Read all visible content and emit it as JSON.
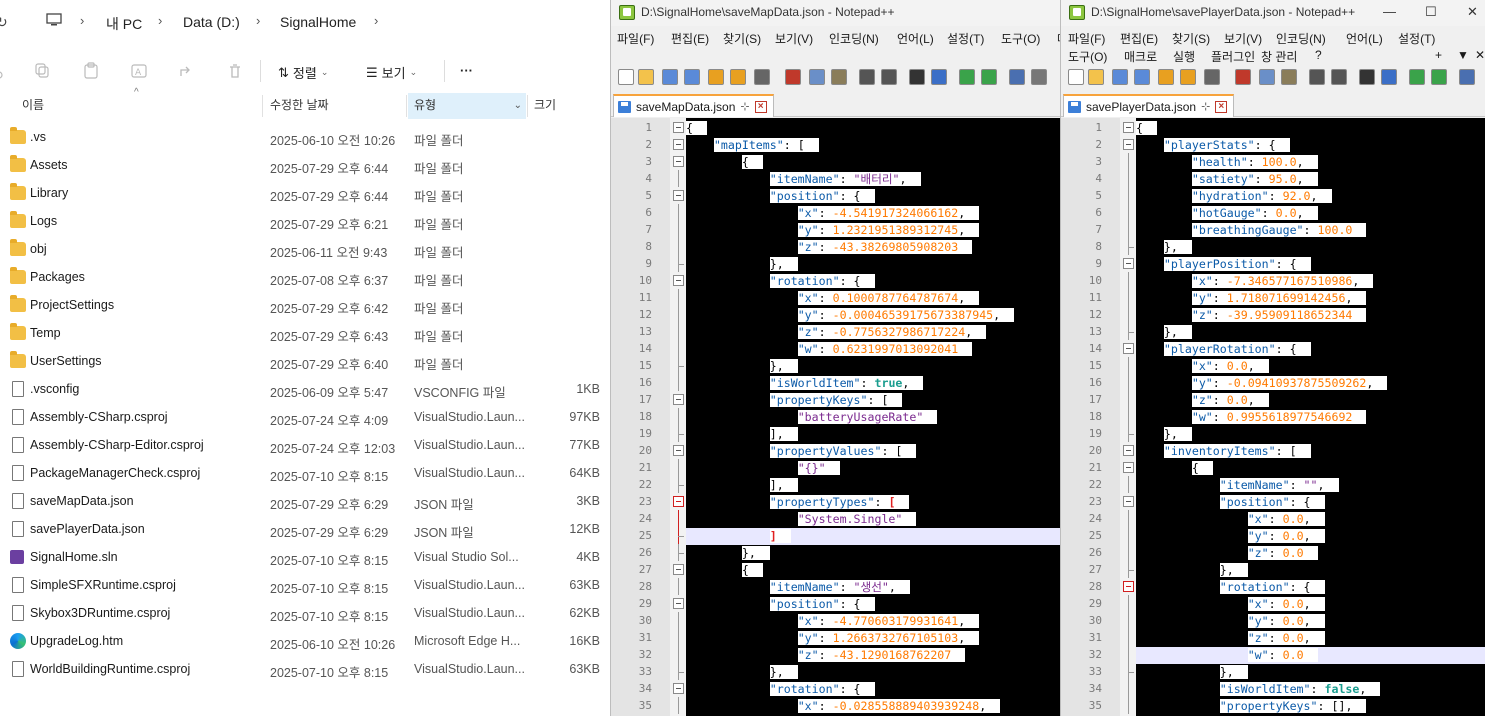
{
  "explorer": {
    "breadcrumb": [
      "내 PC",
      "Data (D:)",
      "SignalHome"
    ],
    "toolbar": {
      "sort_label": "정렬",
      "view_label": "보기",
      "more_label": "···"
    },
    "columns": {
      "name": "이름",
      "modified": "수정한 날짜",
      "type": "유형",
      "size": "크기"
    },
    "files": [
      {
        "icon": "folder-icon",
        "name": ".vs",
        "date": "2025-06-10 오전 10:26",
        "type": "파일 폴더",
        "size": ""
      },
      {
        "icon": "folder-icon",
        "name": "Assets",
        "date": "2025-07-29 오후 6:44",
        "type": "파일 폴더",
        "size": ""
      },
      {
        "icon": "folder-icon",
        "name": "Library",
        "date": "2025-07-29 오후 6:44",
        "type": "파일 폴더",
        "size": ""
      },
      {
        "icon": "folder-icon",
        "name": "Logs",
        "date": "2025-07-29 오후 6:21",
        "type": "파일 폴더",
        "size": ""
      },
      {
        "icon": "folder-icon",
        "name": "obj",
        "date": "2025-06-11 오전 9:43",
        "type": "파일 폴더",
        "size": ""
      },
      {
        "icon": "folder-icon",
        "name": "Packages",
        "date": "2025-07-08 오후 6:37",
        "type": "파일 폴더",
        "size": ""
      },
      {
        "icon": "folder-icon",
        "name": "ProjectSettings",
        "date": "2025-07-29 오후 6:42",
        "type": "파일 폴더",
        "size": ""
      },
      {
        "icon": "folder-icon",
        "name": "Temp",
        "date": "2025-07-29 오후 6:43",
        "type": "파일 폴더",
        "size": ""
      },
      {
        "icon": "folder-icon",
        "name": "UserSettings",
        "date": "2025-07-29 오후 6:40",
        "type": "파일 폴더",
        "size": ""
      },
      {
        "icon": "file-icon",
        "name": ".vsconfig",
        "date": "2025-06-09 오후 5:47",
        "type": "VSCONFIG 파일",
        "size": "1KB"
      },
      {
        "icon": "file-icon",
        "name": "Assembly-CSharp.csproj",
        "date": "2025-07-24 오후 4:09",
        "type": "VisualStudio.Laun...",
        "size": "97KB"
      },
      {
        "icon": "file-icon",
        "name": "Assembly-CSharp-Editor.csproj",
        "date": "2025-07-24 오후 12:03",
        "type": "VisualStudio.Laun...",
        "size": "77KB"
      },
      {
        "icon": "file-icon",
        "name": "PackageManagerCheck.csproj",
        "date": "2025-07-10 오후 8:15",
        "type": "VisualStudio.Laun...",
        "size": "64KB"
      },
      {
        "icon": "file-icon",
        "name": "saveMapData.json",
        "date": "2025-07-29 오후 6:29",
        "type": "JSON 파일",
        "size": "3KB"
      },
      {
        "icon": "file-icon",
        "name": "savePlayerData.json",
        "date": "2025-07-29 오후 6:29",
        "type": "JSON 파일",
        "size": "12KB"
      },
      {
        "icon": "sln-icon",
        "name": "SignalHome.sln",
        "date": "2025-07-10 오후 8:15",
        "type": "Visual Studio Sol...",
        "size": "4KB"
      },
      {
        "icon": "file-icon",
        "name": "SimpleSFXRuntime.csproj",
        "date": "2025-07-10 오후 8:15",
        "type": "VisualStudio.Laun...",
        "size": "63KB"
      },
      {
        "icon": "file-icon",
        "name": "Skybox3DRuntime.csproj",
        "date": "2025-07-10 오후 8:15",
        "type": "VisualStudio.Laun...",
        "size": "62KB"
      },
      {
        "icon": "edge-icon",
        "name": "UpgradeLog.htm",
        "date": "2025-06-10 오전 10:26",
        "type": "Microsoft Edge H...",
        "size": "16KB"
      },
      {
        "icon": "file-icon",
        "name": "WorldBuildingRuntime.csproj",
        "date": "2025-07-10 오후 8:15",
        "type": "VisualStudio.Laun...",
        "size": "63KB"
      }
    ]
  },
  "npp1": {
    "title": "D:\\SignalHome\\saveMapData.json - Notepad++",
    "menu": [
      "파일(F)",
      "편집(E)",
      "찾기(S)",
      "보기(V)",
      "인코딩(N)",
      "언어(L)",
      "설정(T)",
      "도구(O)",
      "매"
    ],
    "tab": "saveMapData.json",
    "lines": [
      "{",
      "    \"mapItems\": [",
      "        {",
      "            \"itemName\": \"배터리\",",
      "            \"position\": {",
      "                \"x\": -4.541917324066162,",
      "                \"y\": 1.2321951389312745,",
      "                \"z\": -43.38269805908203",
      "            },",
      "            \"rotation\": {",
      "                \"x\": 0.1000787764787674,",
      "                \"y\": -0.00046539175673387945,",
      "                \"z\": -0.7756327986717224,",
      "                \"w\": 0.6231997013092041",
      "            },",
      "            \"isWorldItem\": true,",
      "            \"propertyKeys\": [",
      "                \"batteryUsageRate\"",
      "            ],",
      "            \"propertyValues\": [",
      "                \"{}\"",
      "            ],",
      "            \"propertyTypes\": [",
      "                \"System.Single\"",
      "            ]",
      "        },",
      "        {",
      "            \"itemName\": \"생선\",",
      "            \"position\": {",
      "                \"x\": -4.770603179931641,",
      "                \"y\": 1.2663732767105103,",
      "                \"z\": -43.1290168762207",
      "            },",
      "            \"rotation\": {",
      "                \"x\": -0.028558889403939248,"
    ]
  },
  "npp2": {
    "title": "D:\\SignalHome\\savePlayerData.json - Notepad++",
    "menu_row1": [
      "파일(F)",
      "편집(E)",
      "찾기(S)",
      "보기(V)",
      "인코딩(N)",
      "언어(L)",
      "설정(T)"
    ],
    "menu_row2": [
      "도구(O)",
      "매크로",
      "실행",
      "플러그인",
      "창 관리",
      "?"
    ],
    "tab": "savePlayerData.json",
    "lines": [
      "{",
      "    \"playerStats\": {",
      "        \"health\": 100.0,",
      "        \"satiety\": 95.0,",
      "        \"hydration\": 92.0,",
      "        \"hotGauge\": 0.0,",
      "        \"breathingGauge\": 100.0",
      "    },",
      "    \"playerPosition\": {",
      "        \"x\": -7.346577167510986,",
      "        \"y\": 1.718071699142456,",
      "        \"z\": -39.95909118652344",
      "    },",
      "    \"playerRotation\": {",
      "        \"x\": 0.0,",
      "        \"y\": -0.09410937875509262,",
      "        \"z\": 0.0,",
      "        \"w\": 0.9955618977546692",
      "    },",
      "    \"inventoryItems\": [",
      "        {",
      "            \"itemName\": \"\",",
      "            \"position\": {",
      "                \"x\": 0.0,",
      "                \"y\": 0.0,",
      "                \"z\": 0.0",
      "            },",
      "            \"rotation\": {",
      "                \"x\": 0.0,",
      "                \"y\": 0.0,",
      "                \"z\": 0.0,",
      "                \"w\": 0.0",
      "            },",
      "            \"isWorldItem\": false,",
      "            \"propertyKeys\": [],"
    ]
  }
}
